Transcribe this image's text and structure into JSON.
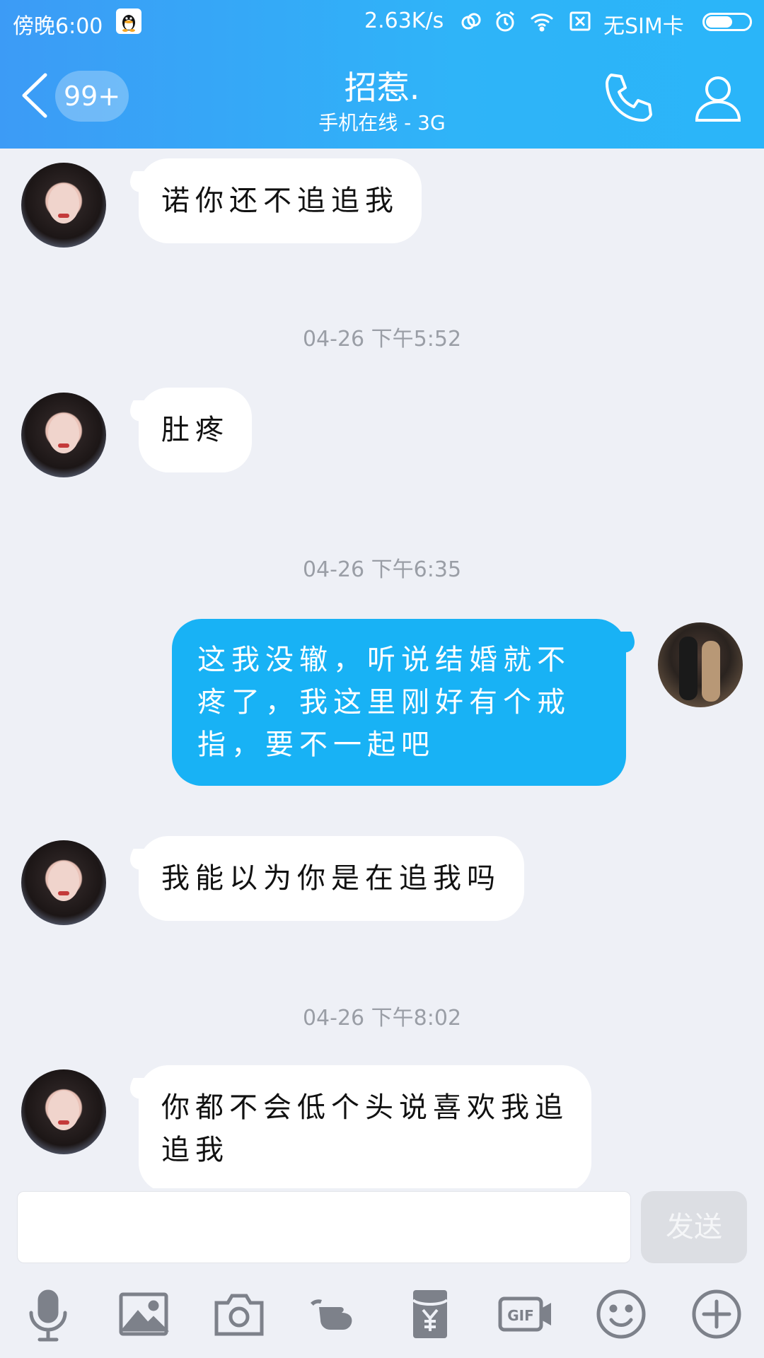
{
  "status_bar": {
    "time": "傍晚6:00",
    "net_speed": "2.63K/s",
    "sim_text": "无SIM卡",
    "icons": [
      "qq-icon",
      "sync-icon",
      "alarm-icon",
      "wifi-icon",
      "no-sim-icon",
      "battery-icon"
    ]
  },
  "header": {
    "unread_badge": "99+",
    "title": "招惹.",
    "subtitle": "手机在线 - 3G"
  },
  "messages": [
    {
      "type": "in",
      "text": "诺你还不追追我"
    },
    {
      "type": "time",
      "text": "04-26 下午5:52"
    },
    {
      "type": "in",
      "text": "肚疼"
    },
    {
      "type": "time",
      "text": "04-26 下午6:35"
    },
    {
      "type": "out",
      "text": "这我没辙，听说结婚就不疼了，我这里刚好有个戒指，要不一起吧"
    },
    {
      "type": "in",
      "text": "我能以为你是在追我吗"
    },
    {
      "type": "time",
      "text": "04-26 下午8:02"
    },
    {
      "type": "in",
      "text": "你都不会低个头说喜欢我追追我"
    }
  ],
  "input": {
    "value": "",
    "send_label": "发送"
  },
  "toolbar": [
    "microphone-icon",
    "image-icon",
    "camera-icon",
    "poke-icon",
    "red-packet-icon",
    "gif-icon",
    "emoji-icon",
    "plus-icon"
  ],
  "colors": {
    "header_start": "#3c9bf6",
    "header_end": "#2ab5f9",
    "out_bubble": "#18b2f5",
    "background": "#eef0f6"
  }
}
